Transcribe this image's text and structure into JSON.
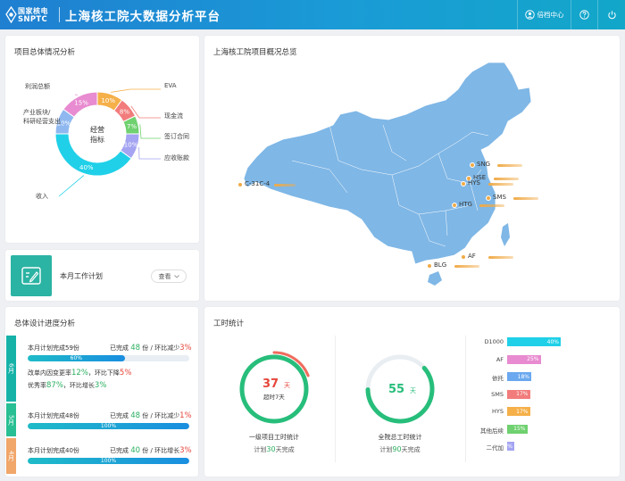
{
  "header": {
    "logo_cn": "国家核电",
    "logo_en": "SNPTC",
    "app_title": "上海核工院大数据分析平台",
    "user_label": "倍档中心"
  },
  "colors": {
    "header": "#1a8fd6",
    "accent": "#1ebbc8",
    "map": "#7fb7e6",
    "marker": "#f0aa47",
    "green": "#2aaf5e",
    "red": "#e5463a"
  },
  "overview": {
    "title": "项目总体情况分析",
    "center_line1": "经营",
    "center_line2": "指标",
    "segments": [
      {
        "label": "收入",
        "value": 40,
        "pct": "40%",
        "color": "#20d0e8"
      },
      {
        "label": "产业板块/\n科研经营支出",
        "value": 10,
        "pct": "10%",
        "color": "#8fb8f0"
      },
      {
        "label": "利润总额",
        "value": 15,
        "pct": "15%",
        "color": "#e88bd0"
      },
      {
        "label": "EVA",
        "value": 10,
        "pct": "10%",
        "color": "#f5b04a"
      },
      {
        "label": "现金流",
        "value": 8,
        "pct": "8%",
        "color": "#f27c7c"
      },
      {
        "label": "签订合同",
        "value": 7,
        "pct": "7%",
        "color": "#6fd16f"
      },
      {
        "label": "应收账款",
        "value": 10,
        "pct": "10%",
        "color": "#a4a4f2"
      }
    ]
  },
  "plan": {
    "label": "本月工作计划",
    "view": "查看"
  },
  "map": {
    "title": "上海核工院项目概况总览",
    "markers": [
      {
        "label": "C-31C-4"
      },
      {
        "label": "SNG"
      },
      {
        "label": "HSE"
      },
      {
        "label": "HYS"
      },
      {
        "label": "SMS"
      },
      {
        "label": "HTG"
      },
      {
        "label": "AF"
      },
      {
        "label": "BLG"
      }
    ]
  },
  "progress": {
    "title": "总体设计进度分析",
    "months": [
      {
        "tab": "6月",
        "plan": "本月计划完成59份",
        "done_label": "已完成",
        "done": "48",
        "unit": "份 / 环比减少",
        "change": "3%",
        "bar_text": "60%",
        "fill": 0.6,
        "extra1_pre": "改单内因变更率",
        "extra1_val": "12%",
        "extra1_mid": "，环比下降",
        "extra1_chg": "5%",
        "extra2_pre": "优秀率",
        "extra2_val": "87%",
        "extra2_mid": "，环比增长",
        "extra2_chg": "3%"
      },
      {
        "tab": "5月",
        "plan": "本月计划完成48份",
        "done_label": "已完成",
        "done": "48",
        "unit": "份 / 环比减少",
        "change": "1%",
        "bar_text": "100%",
        "fill": 1
      },
      {
        "tab": "4月",
        "plan": "本月计划完成40份",
        "done_label": "已完成",
        "done": "40",
        "unit": "份 / 环比增长",
        "change": "3%",
        "bar_text": "100%",
        "fill": 1
      }
    ]
  },
  "worktime": {
    "title": "工时统计",
    "gauge1": {
      "value": "37",
      "unit": "天",
      "over": "超时7天",
      "name": "一级项目工时统计",
      "plan_pre": "计划",
      "plan_val": "30",
      "plan_post": "天完成",
      "fraction": 1,
      "over_fraction": 0.19
    },
    "gauge2": {
      "value": "55",
      "unit": "天",
      "name": "全院总工时统计",
      "plan_pre": "计划",
      "plan_val": "90",
      "plan_post": "天完成",
      "fraction": 0.61
    },
    "bars": [
      {
        "label": "D1000",
        "pct": "40%",
        "value": 40,
        "color": "#20d0e8"
      },
      {
        "label": "AF",
        "pct": "25%",
        "value": 25,
        "color": "#e88bd0"
      },
      {
        "label": "依托",
        "pct": "18%",
        "value": 18,
        "color": "#6aa8ef"
      },
      {
        "label": "SMS",
        "pct": "17%",
        "value": 17,
        "color": "#f27c7c"
      },
      {
        "label": "HYS",
        "pct": "17%",
        "value": 17,
        "color": "#f5b04a"
      },
      {
        "label": "其他后续",
        "pct": "15%",
        "value": 15,
        "color": "#6fd16f"
      },
      {
        "label": "二代加",
        "pct": "3%",
        "value": 3,
        "color": "#a4a4f2"
      }
    ]
  }
}
